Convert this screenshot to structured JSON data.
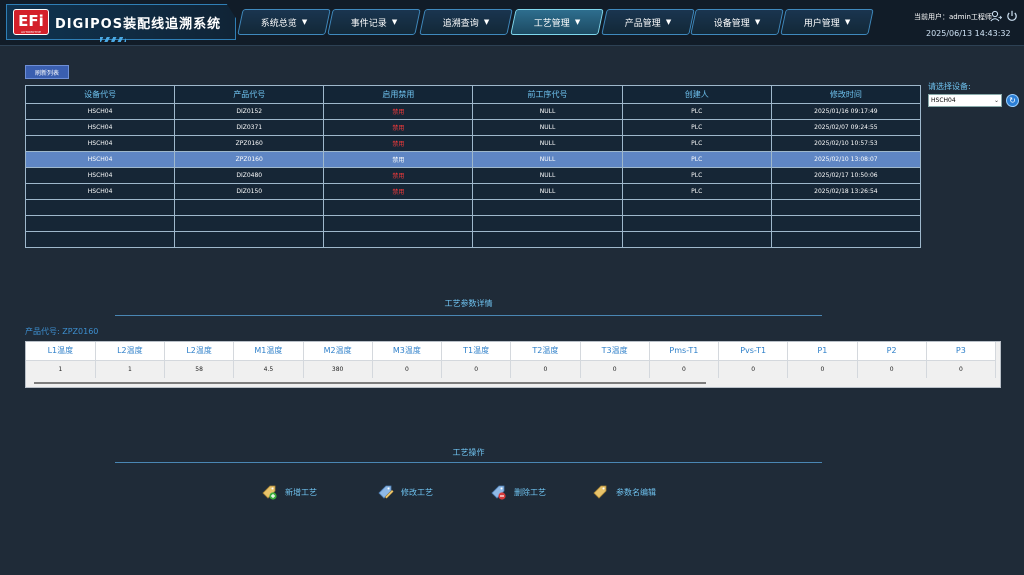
{
  "header": {
    "logo": {
      "mark": "EFi",
      "sub": "AUTOMOTIVE"
    },
    "title": "DIGIPOS装配线追溯系统",
    "nav": [
      {
        "label": "系统总览",
        "active": false
      },
      {
        "label": "事件记录",
        "active": false
      },
      {
        "label": "追溯查询",
        "active": false
      },
      {
        "label": "工艺管理",
        "active": true
      },
      {
        "label": "产品管理",
        "active": false
      },
      {
        "label": "设备管理",
        "active": false
      },
      {
        "label": "用户管理",
        "active": false
      }
    ],
    "user": "当前用户：admin工程师",
    "datetime": "2025/06/13 14:43:32"
  },
  "toolbar": {
    "refresh_label": "刷新列表"
  },
  "device_table": {
    "columns": [
      "设备代号",
      "产品代号",
      "启用禁用",
      "前工序代号",
      "创建人",
      "修改时间"
    ],
    "rows": [
      [
        "HSCH04",
        "DIZ0152",
        "禁用",
        "NULL",
        "PLC",
        "2025/01/16 09:17:49"
      ],
      [
        "HSCH04",
        "DIZ0371",
        "禁用",
        "NULL",
        "PLC",
        "2025/02/07 09:24:55"
      ],
      [
        "HSCH04",
        "ZPZ0160",
        "禁用",
        "NULL",
        "PLC",
        "2025/02/10 10:57:53"
      ],
      [
        "HSCH04",
        "ZPZ0160",
        "禁用",
        "NULL",
        "PLC",
        "2025/02/10 13:08:07"
      ],
      [
        "HSCH04",
        "DIZ0480",
        "禁用",
        "NULL",
        "PLC",
        "2025/02/17 10:50:06"
      ],
      [
        "HSCH04",
        "DIZ0150",
        "禁用",
        "NULL",
        "PLC",
        "2025/02/18 13:26:54"
      ],
      [
        "",
        "",
        "",
        "",
        "",
        ""
      ],
      [
        "",
        "",
        "",
        "",
        "",
        ""
      ],
      [
        "",
        "",
        "",
        "",
        "",
        ""
      ]
    ],
    "selected_row": 3
  },
  "device_select": {
    "label": "请选择设备:",
    "value": "HSCH04"
  },
  "param_section": {
    "title": "工艺参数详情",
    "product_code": "产品代号: ZPZ0160",
    "columns": [
      "L1温度",
      "L2温度",
      "L2温度",
      "M1温度",
      "M2温度",
      "M3温度",
      "T1温度",
      "T2温度",
      "T3温度",
      "Pms-T1",
      "Pvs-T1",
      "P1",
      "P2",
      "P3"
    ],
    "values": [
      "1",
      "1",
      "58",
      "4.5",
      "380",
      "0",
      "0",
      "0",
      "0",
      "0",
      "0",
      "0",
      "0",
      "0"
    ]
  },
  "ops_section": {
    "title": "工艺操作",
    "buttons": [
      {
        "label": "新增工艺",
        "icon": "tag-add-icon"
      },
      {
        "label": "修改工艺",
        "icon": "tag-edit-icon"
      },
      {
        "label": "删除工艺",
        "icon": "tag-delete-icon"
      },
      {
        "label": "参数名编辑",
        "icon": "tag-icon"
      }
    ]
  },
  "colors": {
    "accent": "#6fc3f0",
    "selected_row": "#5f86c4",
    "disabled_text": "#ff3b3b",
    "background": "#1f2b38"
  }
}
